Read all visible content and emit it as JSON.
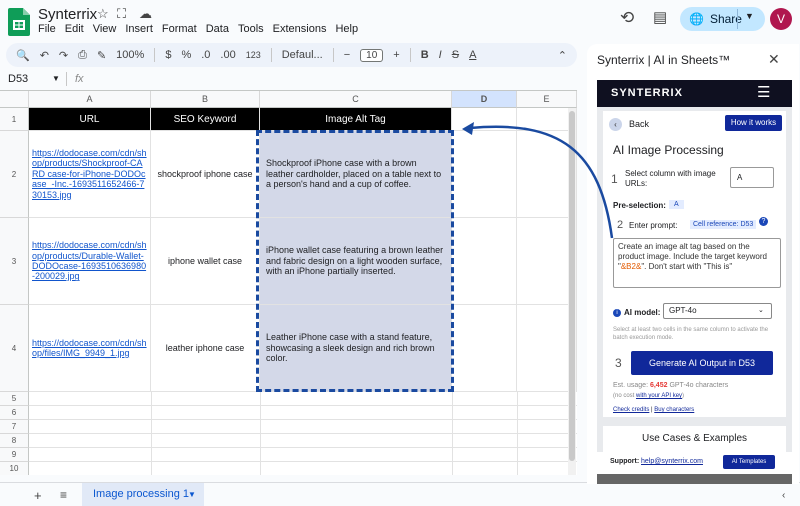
{
  "app": {
    "title": "Synterrix",
    "menus": [
      "File",
      "Edit",
      "View",
      "Insert",
      "Format",
      "Data",
      "Tools",
      "Extensions",
      "Help"
    ],
    "share_label": "Share",
    "avatar_letter": "V"
  },
  "toolbar": {
    "zoom": "100%",
    "currency": "$",
    "percent": "%",
    "decimal_dec": ".0",
    "decimal_inc": ".00",
    "number_format": "123",
    "font": "Defaul...",
    "font_size": "10",
    "bold": "B",
    "italic": "I",
    "strike": "S",
    "text_color": "A"
  },
  "formula": {
    "cell_ref": "D53",
    "fx": "fx",
    "value": ""
  },
  "grid": {
    "columns": [
      "A",
      "B",
      "C",
      "D",
      "E"
    ],
    "rows": [
      "1",
      "2",
      "3",
      "4",
      "5",
      "6",
      "7",
      "8",
      "9",
      "10"
    ],
    "header": {
      "url": "URL",
      "keyword": "SEO Keyword",
      "alt": "Image Alt Tag"
    },
    "data": [
      {
        "url": "https://dodocase.com/cdn/shop/products/Shockproof-CARD case-for-iPhone-DODOcase_-Inc.-1693511652466-730153.jpg",
        "keyword": "shockproof iphone case",
        "alt": "Shockproof iPhone case with a brown leather cardholder, placed on a table next to a person's hand and a cup of coffee."
      },
      {
        "url": "https://dodocase.com/cdn/shop/products/Durable-Wallet-DODOcase-1693510636980-200029.jpg",
        "keyword": "iphone wallet case",
        "alt": "iPhone wallet case featuring a brown leather and fabric design on a light wooden surface, with an iPhone partially inserted."
      },
      {
        "url": "https://dodocase.com/cdn/shop/files/IMG_9949_1.jpg",
        "keyword": "leather iphone case",
        "alt": "Leather iPhone case with a stand feature, showcasing a sleek design and rich brown color."
      }
    ]
  },
  "bottom": {
    "add": "+",
    "all_sheets": "≡",
    "tab": "Image processing 1"
  },
  "side": {
    "title": "Synterrix | AI in Sheets™",
    "brand": "SYNTERRIX",
    "back": "Back",
    "how": "How it works",
    "heading": "AI Image Processing",
    "step1_num": "1",
    "step1_label": "Select column with image URLs:",
    "column_value": "A",
    "preselection_label": "Pre-selection:",
    "preselection_value": "A",
    "step2_num": "2",
    "step2_label": "Enter prompt:",
    "cell_ref": "Cell reference: D53",
    "prompt_before": "Create an image alt tag based on the product image. Include the target keyword \"",
    "prompt_token": "&B2&",
    "prompt_after": "\". Don't start with \"This is\"",
    "ai_model_label": "AI model:",
    "ai_model": "GPT-4o",
    "hint": "Select at least two cells in the same column to activate the batch execution mode.",
    "step3_num": "3",
    "generate": "Generate AI Output in D53",
    "usage_prefix": "Est. usage: ",
    "usage_value": "6,452",
    "usage_suffix": " GPT-4o characters",
    "nocost_prefix": "(no cost ",
    "nocost_link": "with your API key",
    "nocost_suffix": ")",
    "check_credits": "Check credits",
    "buy_characters": "Buy characters",
    "usecases": "Use Cases & Examples",
    "support_label": "Support:",
    "support_email": "help@synterrix.com",
    "ai_templates": "AI Templates"
  },
  "colors": {
    "accent": "#10289a",
    "selection_border": "#1a4aa0",
    "alt_fill": "#d3d8e8",
    "share_bg": "#c2e7ff",
    "avatar": "#b0174f"
  }
}
